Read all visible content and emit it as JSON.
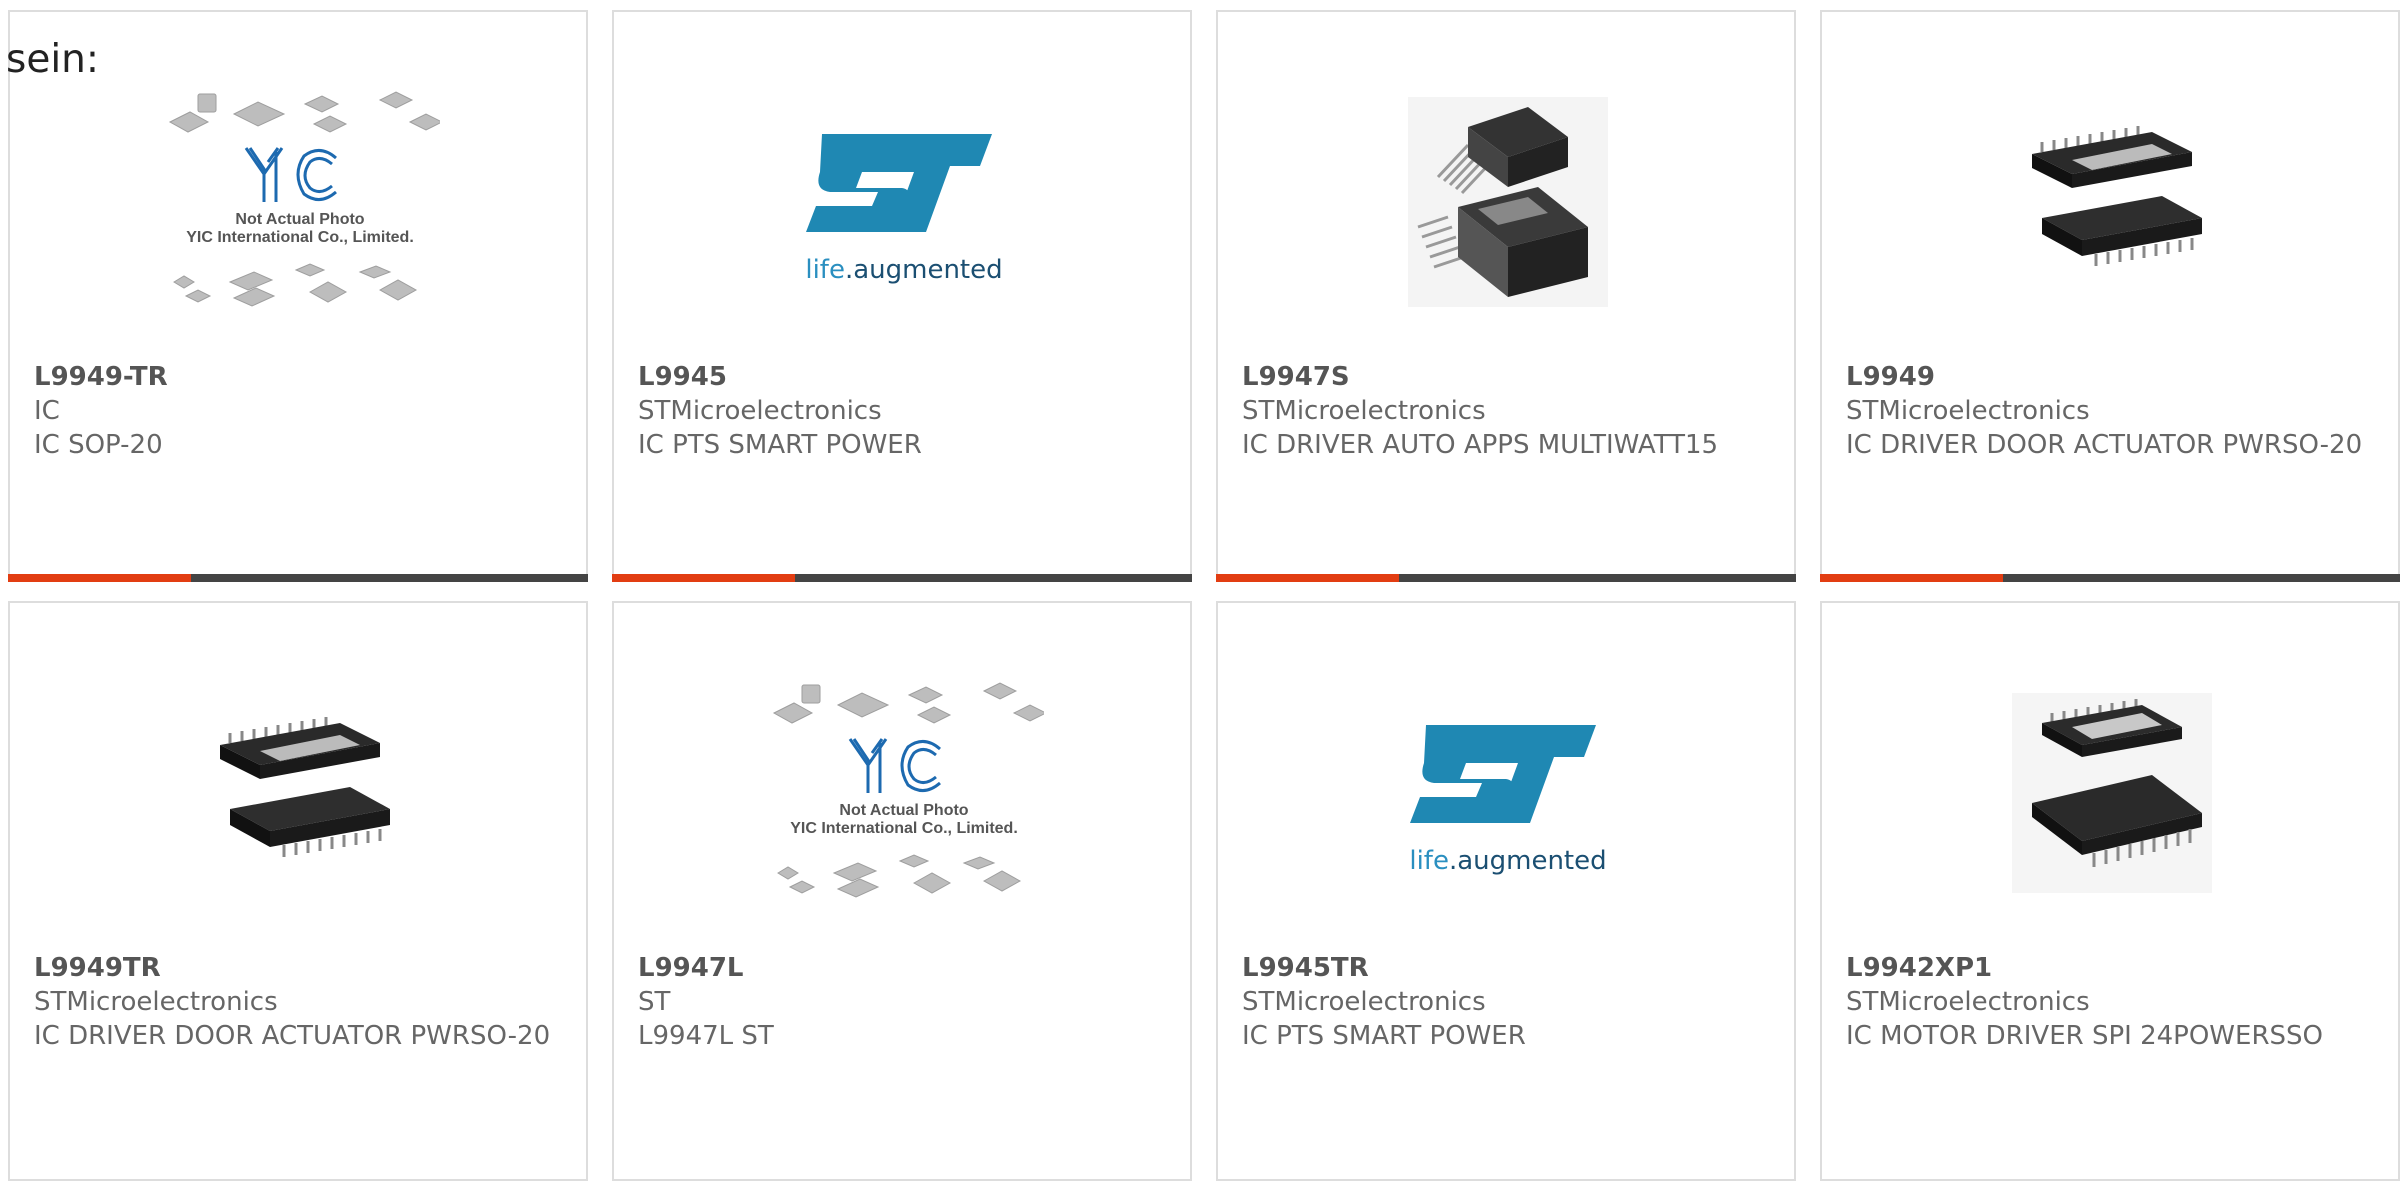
{
  "heading": "sein:",
  "placeholder_image_note": {
    "line1": "Not Actual Photo",
    "line2": "YIC International Co., Limited."
  },
  "st_logo": {
    "wordmark": "ST",
    "tagline_left": "life",
    "tagline_right": ".augmented"
  },
  "colors": {
    "accent": "#e23d12",
    "bar": "#444444",
    "st_blue": "#1f88b3",
    "st_tagline": "#2a8fc0",
    "yic_blue": "#1d6ab0"
  },
  "products": [
    {
      "part": "L9949-TR",
      "maker": "IC",
      "desc": "IC SOP-20",
      "image": "yic-placeholder"
    },
    {
      "part": "L9945",
      "maker": "STMicroelectronics",
      "desc": "IC PTS SMART POWER",
      "image": "st-logo"
    },
    {
      "part": "L9947S",
      "maker": "STMicroelectronics",
      "desc": "IC DRIVER AUTO APPS MULTIWATT15",
      "image": "multiwatt-chip"
    },
    {
      "part": "L9949",
      "maker": "STMicroelectronics",
      "desc": "IC DRIVER DOOR ACTUATOR PWRSO-20",
      "image": "pwrso-chip"
    },
    {
      "part": "L9949TR",
      "maker": "STMicroelectronics",
      "desc": "IC DRIVER DOOR ACTUATOR PWRSO-20",
      "image": "pwrso-chip"
    },
    {
      "part": "L9947L",
      "maker": "ST",
      "desc": "L9947L ST",
      "image": "yic-placeholder"
    },
    {
      "part": "L9945TR",
      "maker": "STMicroelectronics",
      "desc": "IC PTS SMART POWER",
      "image": "st-logo"
    },
    {
      "part": "L9942XP1",
      "maker": "STMicroelectronics",
      "desc": "IC MOTOR DRIVER SPI 24POWERSSO",
      "image": "powersso-chip"
    }
  ]
}
